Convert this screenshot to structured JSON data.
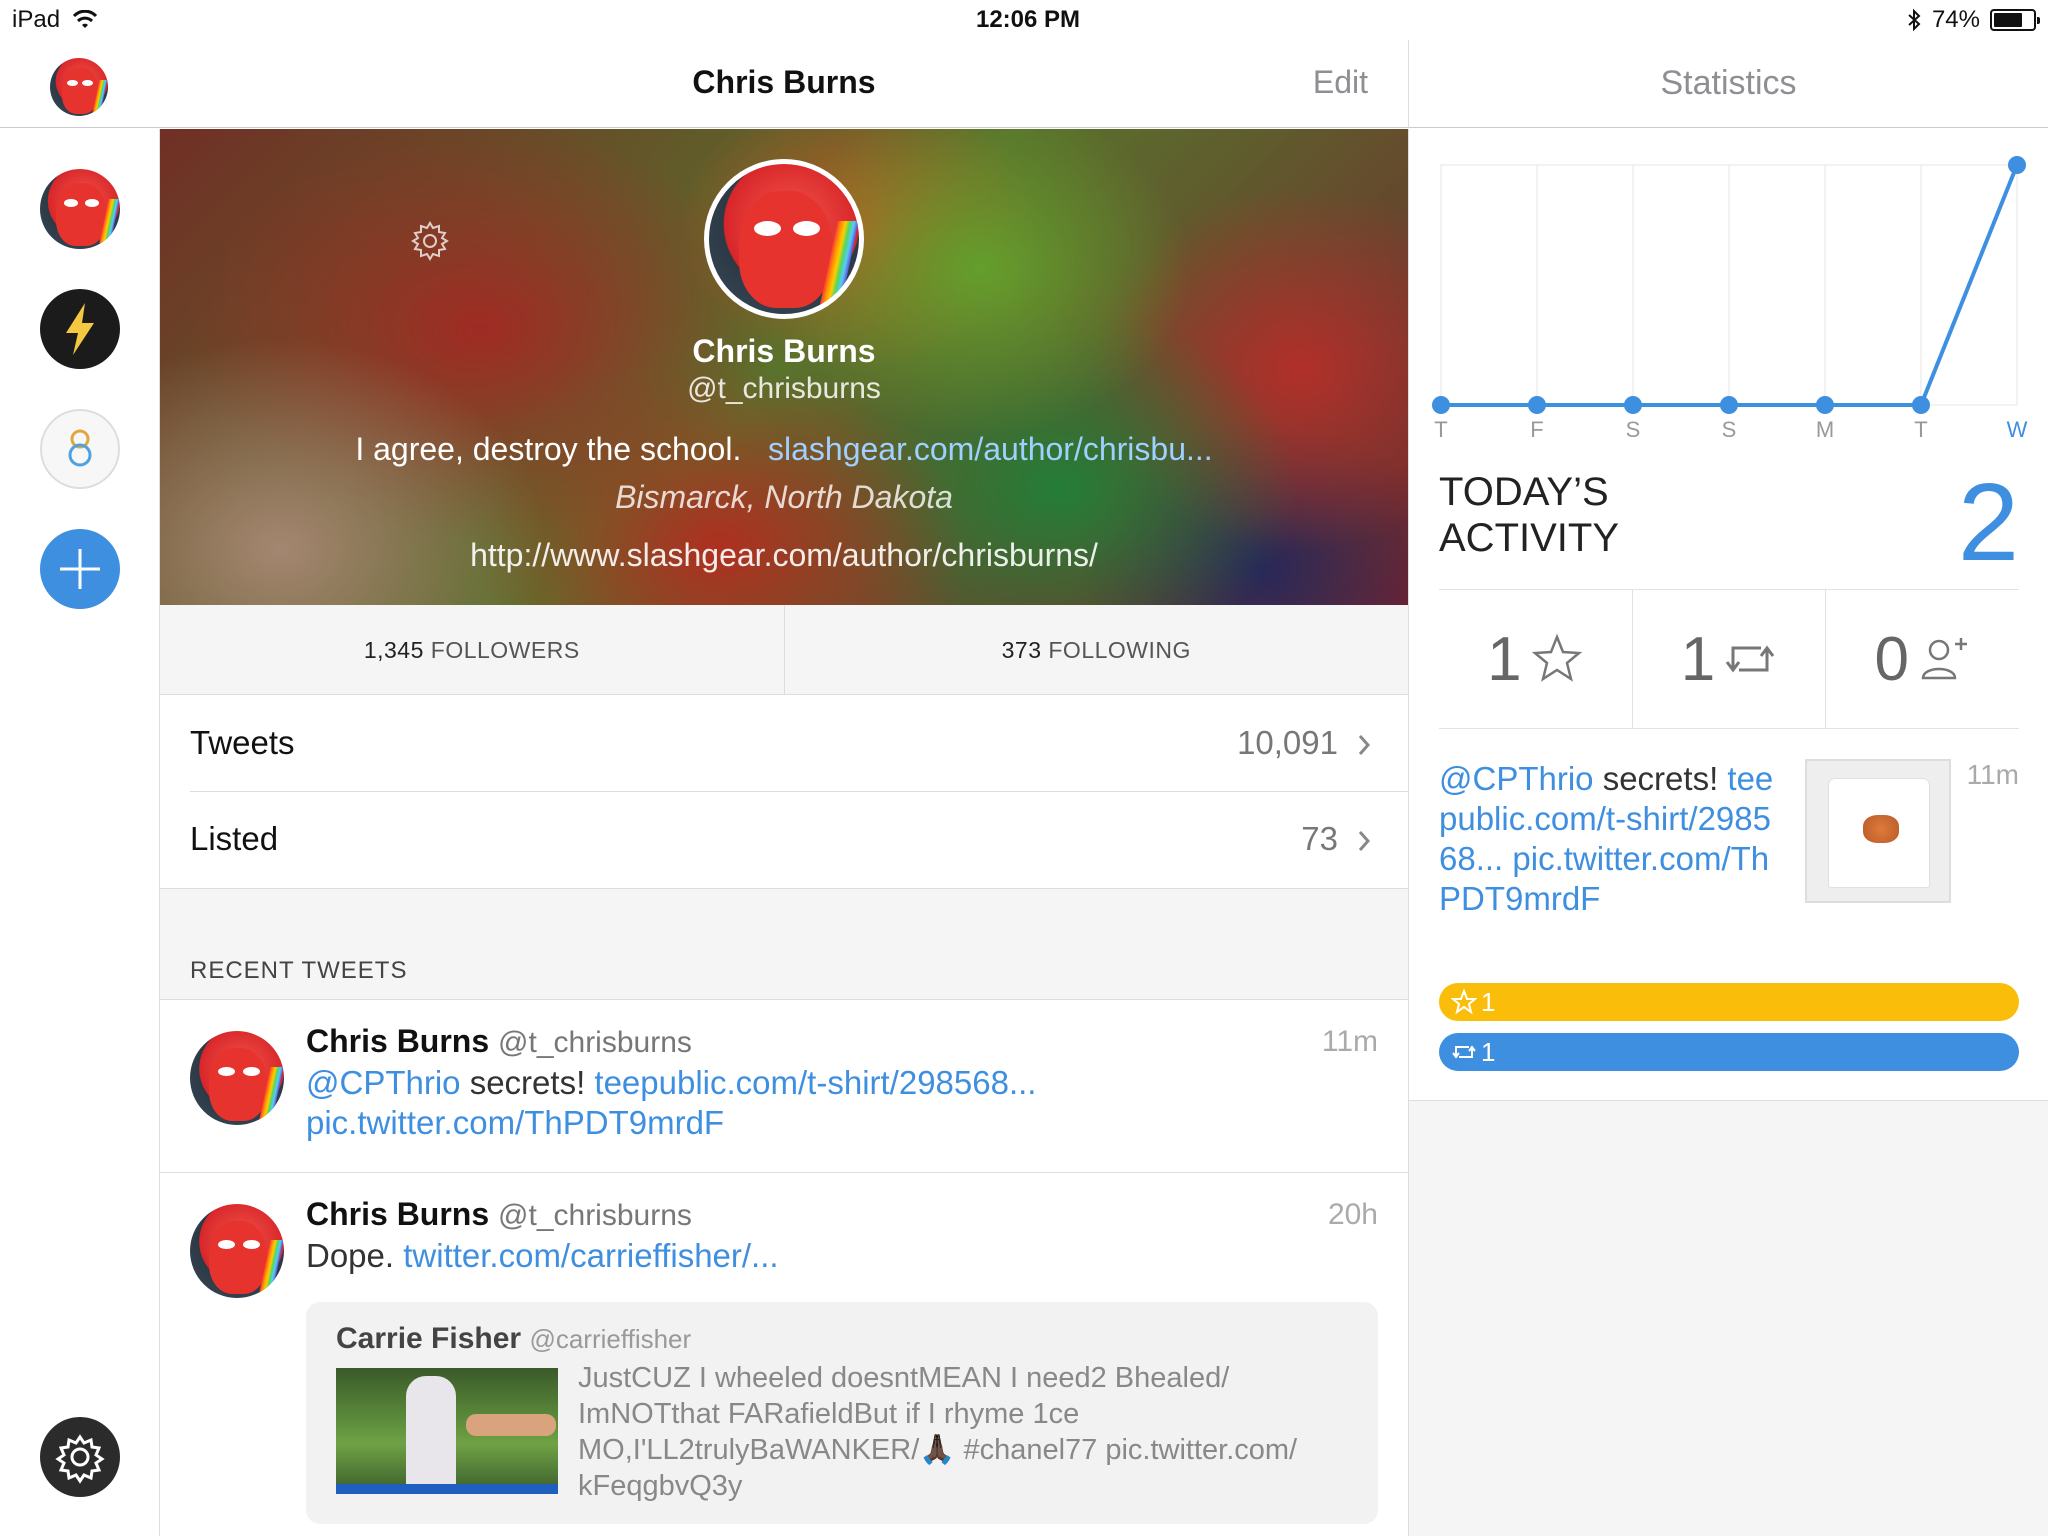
{
  "status_bar": {
    "device": "iPad",
    "time": "12:06 PM",
    "battery": "74%",
    "battery_level": 0.74
  },
  "nav": {
    "title": "Chris Burns",
    "edit_label": "Edit",
    "right_title": "Statistics"
  },
  "profile": {
    "name": "Chris Burns",
    "handle": "@t_chrisburns",
    "bio_text": "I agree, destroy the school.",
    "bio_link": "slashgear.com/author/chrisbu...",
    "location": "Bismarck, North Dakota",
    "url": "http://www.slashgear.com/author/chrisburns/"
  },
  "counts": {
    "followers_value": "1,345",
    "followers_label": "FOLLOWERS",
    "following_value": "373",
    "following_label": "FOLLOWING"
  },
  "rows": {
    "tweets_label": "Tweets",
    "tweets_value": "10,091",
    "listed_label": "Listed",
    "listed_value": "73"
  },
  "recent_header": "RECENT TWEETS",
  "tweets": [
    {
      "name": "Chris Burns",
      "handle": "@t_chrisburns",
      "time": "11m",
      "mention": "@CPThrio",
      "text": " secrets! ",
      "link1": "teepublic.com/t-shirt/298568...",
      "link2": "pic.twitter.com/ThPDT9mrdF"
    },
    {
      "name": "Chris Burns",
      "handle": "@t_chrisburns",
      "time": "20h",
      "text": "Dope. ",
      "link1": "twitter.com/carrieffisher/...",
      "quote": {
        "name": "Carrie Fisher",
        "handle": "@carrieffisher",
        "text": "JustCUZ I wheeled doesntMEAN I need2 Bhealed/ ImNOTthat FARafieldBut if I rhyme 1ce MO,I'LL2trulyBaWANKER/🙏🏿 #chanel77 pic.twitter.com/ kFeqgbvQ3y"
      }
    }
  ],
  "stats": {
    "chart_data": {
      "type": "line",
      "categories": [
        "T",
        "F",
        "S",
        "S",
        "M",
        "T",
        "W"
      ],
      "values": [
        0,
        0,
        0,
        0,
        0,
        0,
        2
      ],
      "ylim": [
        0,
        2
      ],
      "grid": true,
      "color": "#3f8fe0"
    },
    "today_title": "TODAY’S ACTIVITY",
    "today_count": "2",
    "favorites": "1",
    "retweets": "1",
    "new_followers": "0",
    "tweet": {
      "mention": "@CPThrio",
      "text": " secrets! ",
      "link1": "teepublic.com/t-shirt/298568...",
      "link2": "pic.twitter.com/ThPDT9mrdF",
      "time": "11m"
    },
    "fav_pill": "1",
    "rt_pill": "1"
  },
  "colors": {
    "accent": "#3f8fe0",
    "fav": "#f9bd0a",
    "rt": "#3f8fe0"
  }
}
